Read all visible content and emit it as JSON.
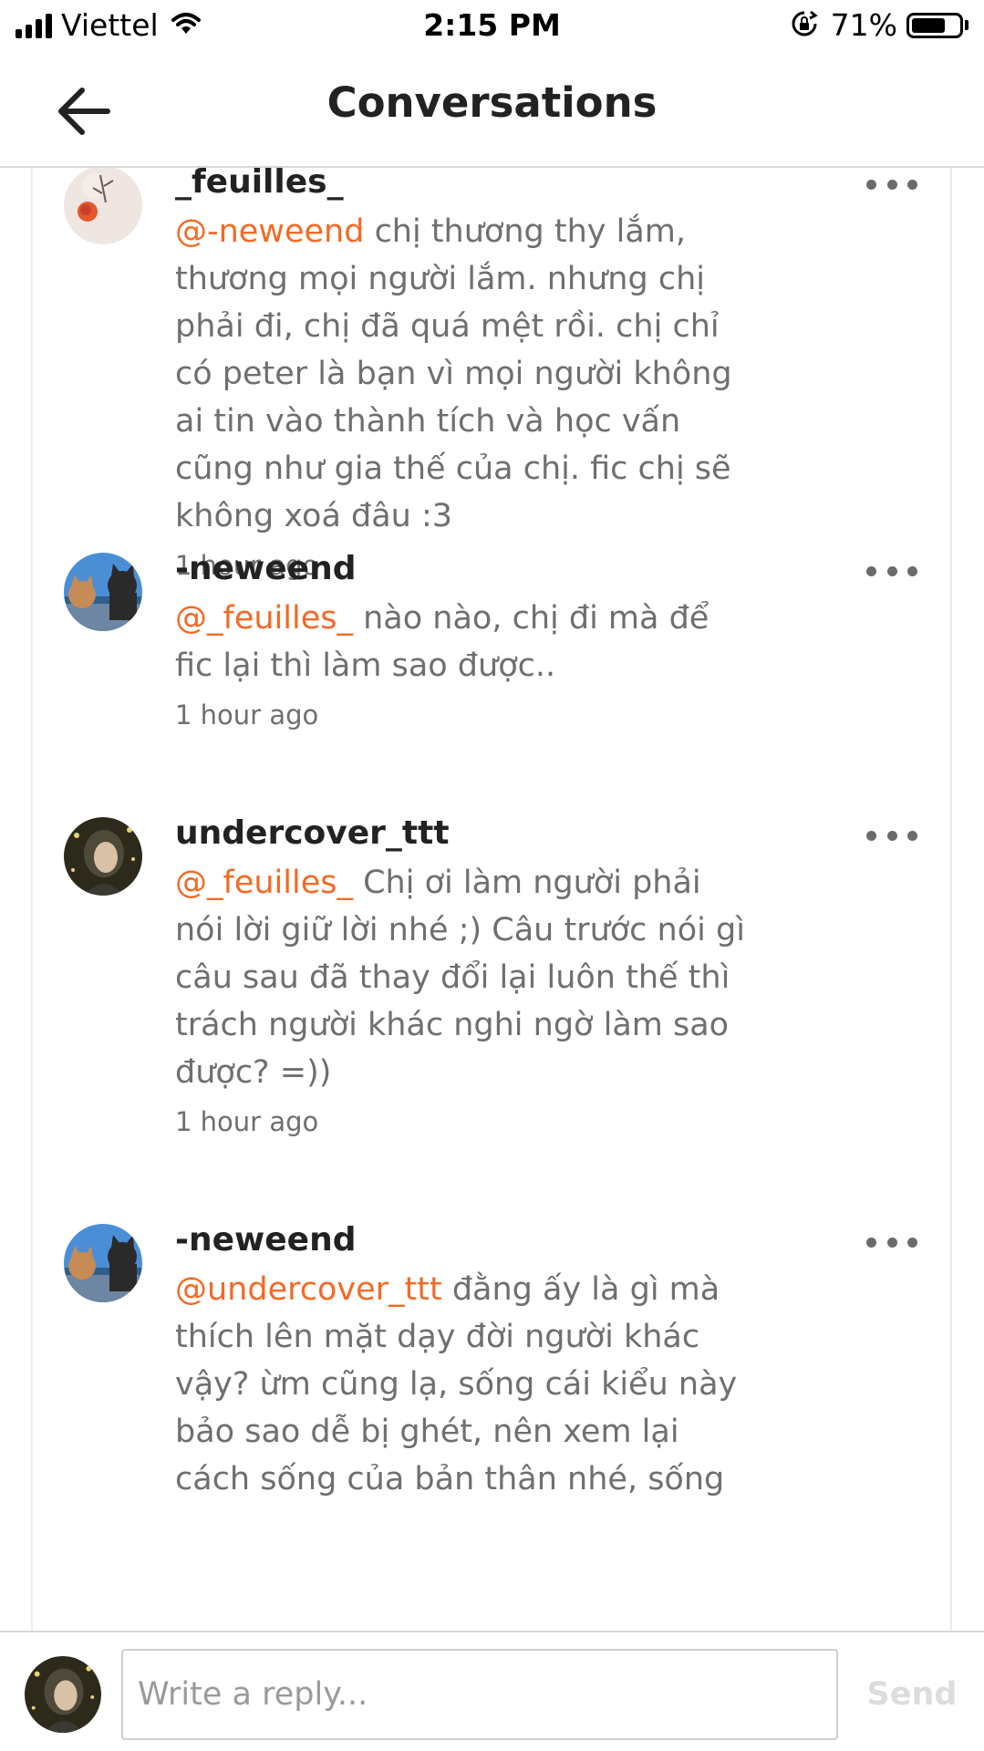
{
  "status_bar": {
    "carrier": "Viettel",
    "time": "2:15 PM",
    "battery_percent": "71%",
    "battery_level": 0.71
  },
  "header": {
    "title": "Conversations",
    "back_icon": "arrow-left-icon"
  },
  "comments": [
    {
      "username": "_feuilles_",
      "mention": "@-neweend",
      "text": "  chị thương thy lắm, thương mọi người lắm. nhưng chị phải đi, chị đã quá mệt rồi. chị chỉ có peter là bạn vì mọi người không ai tin vào thành tích và học vấn cũng như gia thế của chị. fic chị sẽ không xoá đâu :3",
      "time": "1 hour ago",
      "avatar": "rose-avatar"
    },
    {
      "username": "-neweend",
      "mention": "@_feuilles_",
      "text": " nào nào, chị đi mà để fic lại thì làm sao được..",
      "time": "1 hour ago",
      "avatar": "cats-avatar"
    },
    {
      "username": "undercover_ttt",
      "mention": "@_feuilles_",
      "text": " Chị ơi làm người phải nói lời giữ lời nhé ;) Câu trước nói gì câu sau đã thay đổi lại luôn thế thì trách người khác nghi ngờ làm sao được? =))",
      "time": "1 hour ago",
      "avatar": "portrait-avatar"
    },
    {
      "username": "-neweend",
      "mention": "@undercover_ttt",
      "text": " đằng ấy là gì mà thích lên mặt dạy đời người khác vậy? ừm cũng lạ, sống cái kiểu này bảo sao dễ bị ghét, nên xem lại cách sống của bản thân nhé, sống",
      "time": "",
      "avatar": "cats-avatar"
    }
  ],
  "reply": {
    "placeholder": "Write a reply...",
    "send_label": "Send"
  }
}
